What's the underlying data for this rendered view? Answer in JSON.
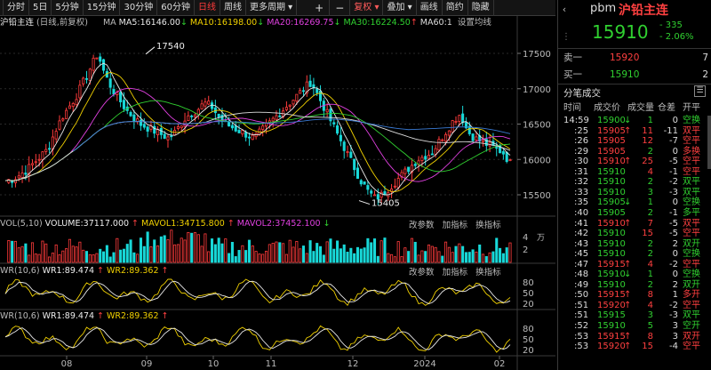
{
  "toolbar": {
    "items": [
      "分时",
      "5日",
      "5分钟",
      "15分钟",
      "30分钟",
      "60分钟",
      "日线",
      "周线",
      "更多周期"
    ],
    "active": "日线",
    "tools": [
      "+",
      "−",
      "复权",
      "叠加",
      "画线",
      "简约",
      "隐藏"
    ]
  },
  "chart": {
    "title": "沪铅主连",
    "subtitle": "(日线,前复权)",
    "ma_label": "MA",
    "ma_values": [
      {
        "label": "MA5:16146.00",
        "arrow": "↓",
        "color": "#e8e8e8"
      },
      {
        "label": "MA10:16198.00",
        "arrow": "↓",
        "color": "#f0d000"
      },
      {
        "label": "MA20:16269.75",
        "arrow": "↓",
        "color": "#e040e0"
      },
      {
        "label": "MA30:16224.50",
        "arrow": "↑",
        "color": "#30d030"
      },
      {
        "label": "MA60:1",
        "arrow": "",
        "color": "#dddddd"
      }
    ],
    "ma_settings": "设置均线",
    "y_ticks": [
      "17500",
      "17000",
      "16500",
      "16000",
      "15500"
    ],
    "high_label": "17540",
    "low_label": "15405",
    "x_ticks": [
      "08",
      "09",
      "10",
      "11",
      "12",
      "2024",
      "02"
    ]
  },
  "volume": {
    "legend": "VOL(5,10)",
    "vol_label": "VOLUME:37117.000",
    "vol_arrow": "↑",
    "mavol1": "MAVOL1:34715.800",
    "mavol1_arrow": "↑",
    "mavol2": "MAVOL2:37452.100",
    "mavol2_arrow": "↓",
    "buttons": [
      "改参数",
      "加指标",
      "换指标"
    ],
    "y_ticks": [
      "4",
      "2"
    ],
    "y_unit": "万"
  },
  "wr1": {
    "legend": "WR(10,6)",
    "wr1": "WR1:89.474",
    "wr1_arrow": "↑",
    "wr2": "WR2:89.362",
    "wr2_arrow": "↑",
    "buttons": [
      "改参数",
      "加指标",
      "换指标"
    ],
    "y_ticks": [
      "80",
      "50",
      "20"
    ]
  },
  "wr2": {
    "legend": "WR(10,6)",
    "wr1": "WR1:89.474",
    "wr1_arrow": "↑",
    "wr2": "WR2:89.362",
    "wr2_arrow": "↑",
    "y_ticks": [
      "80",
      "50",
      "20"
    ]
  },
  "quote": {
    "code": "pbm",
    "name": "沪铅主连",
    "price": "15910",
    "change": "- 335",
    "pct": "- 2.06%",
    "sell_label": "卖一",
    "sell_price": "15920",
    "sell_vol": "7",
    "buy_label": "买一",
    "buy_price": "15910",
    "buy_vol": "2"
  },
  "ticks": {
    "title": "分笔成交",
    "headers": [
      "时间",
      "成交价",
      "成交量",
      "仓差",
      "开平"
    ],
    "rows": [
      {
        "t": "14:59",
        "p": "15900",
        "a": "↓",
        "pc": "#30d030",
        "v": "1",
        "vc": "#30d030",
        "d": "0",
        "k": "空换",
        "kc": "#30d030"
      },
      {
        "t": ":25",
        "p": "15905",
        "a": "↑",
        "pc": "#ff4040",
        "v": "11",
        "vc": "#ff4040",
        "d": "-11",
        "k": "双平",
        "kc": "#ff4040"
      },
      {
        "t": ":26",
        "p": "15905",
        "a": "",
        "pc": "#ff4040",
        "v": "12",
        "vc": "#ff4040",
        "d": "-7",
        "k": "空平",
        "kc": "#ff4040"
      },
      {
        "t": ":29",
        "p": "15905",
        "a": "",
        "pc": "#ff4040",
        "v": "2",
        "vc": "#30d030",
        "d": "0",
        "k": "多换",
        "kc": "#ff4040"
      },
      {
        "t": ":30",
        "p": "15910",
        "a": "↑",
        "pc": "#ff4040",
        "v": "25",
        "vc": "#ff4040",
        "d": "-5",
        "k": "空平",
        "kc": "#ff4040"
      },
      {
        "t": ":31",
        "p": "15910",
        "a": "",
        "pc": "#30d030",
        "v": "4",
        "vc": "#ff4040",
        "d": "-1",
        "k": "空平",
        "kc": "#ff4040"
      },
      {
        "t": ":32",
        "p": "15910",
        "a": "",
        "pc": "#30d030",
        "v": "2",
        "vc": "#30d030",
        "d": "-2",
        "k": "双平",
        "kc": "#30d030"
      },
      {
        "t": ":33",
        "p": "15910",
        "a": "",
        "pc": "#30d030",
        "v": "3",
        "vc": "#30d030",
        "d": "-3",
        "k": "双平",
        "kc": "#30d030"
      },
      {
        "t": ":35",
        "p": "15905",
        "a": "↓",
        "pc": "#30d030",
        "v": "1",
        "vc": "#30d030",
        "d": "0",
        "k": "空换",
        "kc": "#30d030"
      },
      {
        "t": ":40",
        "p": "15905",
        "a": "",
        "pc": "#30d030",
        "v": "2",
        "vc": "#30d030",
        "d": "-1",
        "k": "多平",
        "kc": "#30d030"
      },
      {
        "t": ":41",
        "p": "15910",
        "a": "↑",
        "pc": "#ff4040",
        "v": "7",
        "vc": "#ff4040",
        "d": "-5",
        "k": "双平",
        "kc": "#ff4040"
      },
      {
        "t": ":42",
        "p": "15910",
        "a": "",
        "pc": "#30d030",
        "v": "15",
        "vc": "#ff4040",
        "d": "-5",
        "k": "空平",
        "kc": "#ff4040"
      },
      {
        "t": ":43",
        "p": "15910",
        "a": "",
        "pc": "#30d030",
        "v": "2",
        "vc": "#30d030",
        "d": "2",
        "k": "双开",
        "kc": "#30d030"
      },
      {
        "t": ":45",
        "p": "15910",
        "a": "",
        "pc": "#30d030",
        "v": "2",
        "vc": "#30d030",
        "d": "0",
        "k": "空换",
        "kc": "#30d030"
      },
      {
        "t": ":47",
        "p": "15915",
        "a": "↑",
        "pc": "#ff4040",
        "v": "4",
        "vc": "#ff4040",
        "d": "-2",
        "k": "空平",
        "kc": "#ff4040"
      },
      {
        "t": ":48",
        "p": "15910",
        "a": "↓",
        "pc": "#30d030",
        "v": "1",
        "vc": "#30d030",
        "d": "0",
        "k": "空换",
        "kc": "#30d030"
      },
      {
        "t": ":49",
        "p": "15910",
        "a": "",
        "pc": "#30d030",
        "v": "2",
        "vc": "#30d030",
        "d": "2",
        "k": "双开",
        "kc": "#30d030"
      },
      {
        "t": ":50",
        "p": "15915",
        "a": "↑",
        "pc": "#ff4040",
        "v": "8",
        "vc": "#ff4040",
        "d": "1",
        "k": "多开",
        "kc": "#ff4040"
      },
      {
        "t": ":51",
        "p": "15920",
        "a": "↑",
        "pc": "#ff4040",
        "v": "4",
        "vc": "#ff4040",
        "d": "-2",
        "k": "空平",
        "kc": "#ff4040"
      },
      {
        "t": ":51",
        "p": "15915",
        "a": "",
        "pc": "#30d030",
        "v": "3",
        "vc": "#30d030",
        "d": "-3",
        "k": "双平",
        "kc": "#30d030"
      },
      {
        "t": ":52",
        "p": "15910",
        "a": "",
        "pc": "#30d030",
        "v": "5",
        "vc": "#30d030",
        "d": "3",
        "k": "空开",
        "kc": "#30d030"
      },
      {
        "t": ":53",
        "p": "15915",
        "a": "↑",
        "pc": "#ff4040",
        "v": "8",
        "vc": "#ff4040",
        "d": "3",
        "k": "双开",
        "kc": "#ff4040"
      },
      {
        "t": ":53",
        "p": "15920",
        "a": "↑",
        "pc": "#ff4040",
        "v": "15",
        "vc": "#ff4040",
        "d": "-4",
        "k": "空平",
        "kc": "#ff4040"
      }
    ]
  }
}
